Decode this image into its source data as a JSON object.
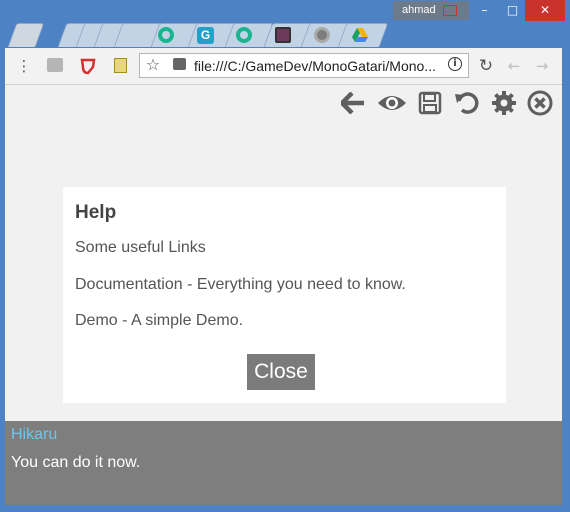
{
  "window": {
    "user": "ahmad",
    "minimize_icon": "minimize-icon",
    "maximize_icon": "maximize-icon",
    "close_icon": "window-close-icon"
  },
  "tabs": [
    {
      "icon": "new-tab-icon",
      "color": "#cfd7e0"
    },
    {
      "icon": "tab",
      "color": "#c3d3e6"
    },
    {
      "icon": "tab",
      "color": "#c3d3e6"
    },
    {
      "icon": "tab",
      "color": "#c3d3e6"
    },
    {
      "icon": "teal-circle-icon",
      "color": "#18b58e"
    },
    {
      "icon": "g-letter-icon",
      "color": "#22a1c9"
    },
    {
      "icon": "teal-circle-icon",
      "color": "#18b58e"
    },
    {
      "icon": "image-app-icon",
      "color": "#6c3a5a"
    },
    {
      "icon": "grey-circle-icon",
      "color": "#7d7d7d"
    },
    {
      "icon": "google-drive-icon",
      "color": "#f0b400"
    }
  ],
  "toolbar": {
    "url": "file:///C:/GameDev/MonoGatari/Mono...",
    "icons": [
      "menu-icon",
      "extension-icon",
      "shield-icon",
      "notes-icon",
      "star-icon",
      "site-icon",
      "info-icon",
      "reload-icon",
      "back-icon",
      "forward-icon"
    ]
  },
  "quick_menu": [
    "back-arrow-icon",
    "eye-icon",
    "save-icon",
    "undo-icon",
    "gear-icon",
    "close-circle-icon"
  ],
  "help_dialog": {
    "title": "Help",
    "intro": "Some useful Links",
    "documentation": "Documentation - Everything you need to know.",
    "demo": "Demo - A simple Demo.",
    "close_label": "Close"
  },
  "textbox": {
    "speaker": "Hikaru",
    "speaker_color": "#6cc6ec",
    "text": "You can do it now."
  }
}
